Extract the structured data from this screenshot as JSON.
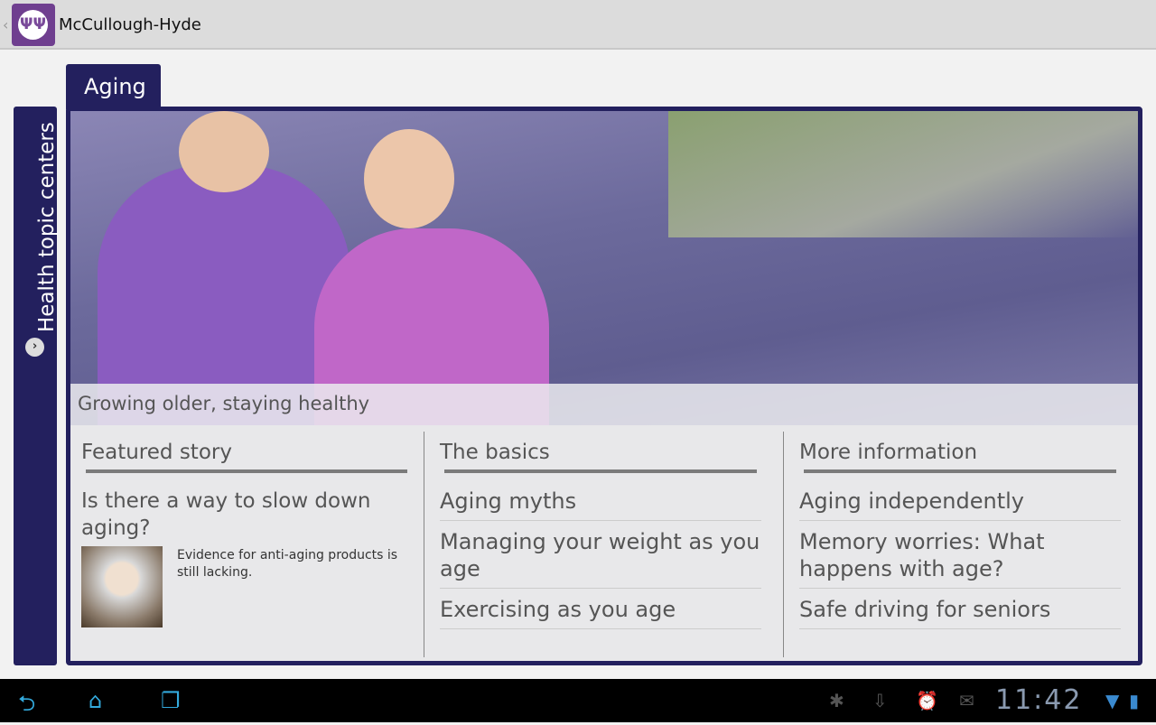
{
  "app": {
    "title": "McCullough-Hyde",
    "logo": "mccullough-hyde-logo"
  },
  "tab": {
    "label": "Aging"
  },
  "sidebar": {
    "label": "Health topic centers",
    "arrow_icon": "chevron-right-icon"
  },
  "hero": {
    "caption": "Growing older, staying healthy"
  },
  "featured": {
    "heading": "Featured story",
    "title": "Is there a way to slow down aging?",
    "summary": "Evidence for anti-aging products is still lacking."
  },
  "basics": {
    "heading": "The basics",
    "items": [
      "Aging myths",
      "Managing your weight as you age",
      "Exercising as you age"
    ]
  },
  "more": {
    "heading": "More information",
    "items": [
      "Aging independently",
      "Memory worries: What happens with age?",
      "Safe driving for seniors"
    ]
  },
  "status": {
    "time": "11:42",
    "icons": [
      "debug-icon",
      "download-icon",
      "alarm-icon",
      "gmail-icon",
      "signal-icon",
      "battery-icon"
    ]
  },
  "colors": {
    "brand": "#23205e",
    "logo": "#6f3f8f"
  }
}
